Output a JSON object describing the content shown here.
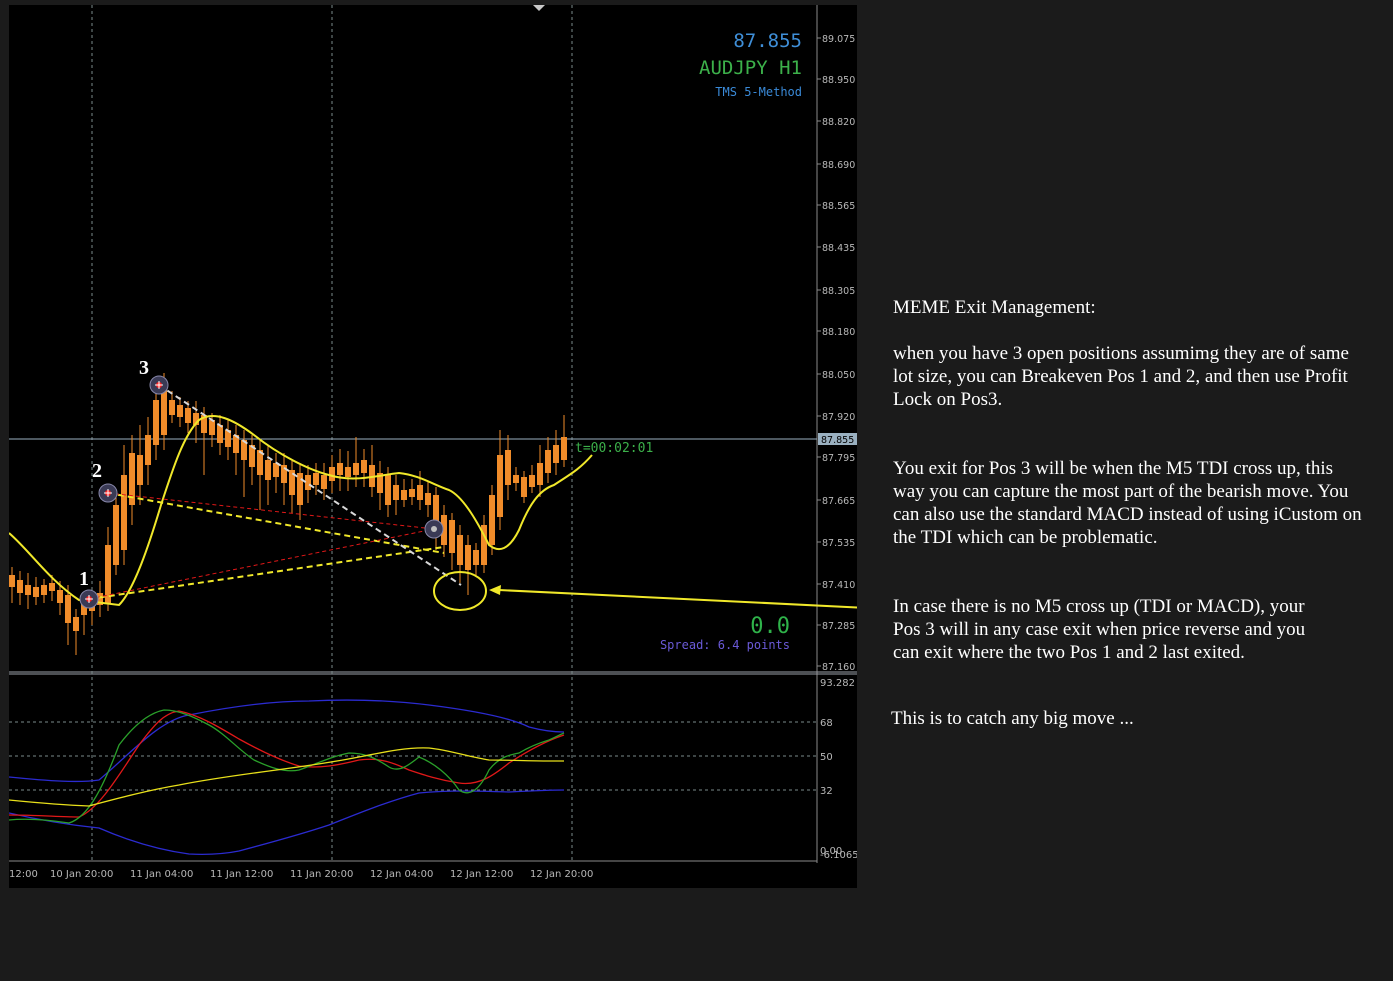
{
  "chart": {
    "price_readout": "87.855",
    "symbol": "AUDJPY H1",
    "indicator_name": "TMS 5-Method",
    "timer": "t=00:02:01",
    "profit": "0.0",
    "spread": "Spread: 6.4 points",
    "current_price_tag": "87.855",
    "colors": {
      "price_readout": "#3f8fd8",
      "symbol": "#3cb04a",
      "indicator_name": "#3a8ad8",
      "timer": "#3cb04a",
      "profit": "#2fb34a",
      "spread": "#6a5ad8",
      "bull_candle": "#4b5bdc",
      "bear_candle": "#f08c2a",
      "ma_line": "#f0e82a",
      "tdi_blue": "#2b2bd0",
      "tdi_red": "#e01818",
      "tdi_green": "#2aa02a",
      "tdi_yellow": "#e8e01a"
    },
    "price_axis": [
      "89.075",
      "88.950",
      "88.820",
      "88.690",
      "88.565",
      "88.435",
      "88.305",
      "88.180",
      "88.050",
      "87.920",
      "87.795",
      "87.665",
      "87.535",
      "87.410",
      "87.285",
      "87.160"
    ],
    "indicator_axis": [
      "93.282",
      "68",
      "50",
      "32",
      "0.00",
      "-6.1065"
    ],
    "time_axis": [
      "12:00",
      "10 Jan 20:00",
      "11 Jan 04:00",
      "11 Jan 12:00",
      "11 Jan 20:00",
      "12 Jan 04:00",
      "12 Jan 12:00",
      "12 Jan 20:00"
    ],
    "position_labels": [
      "1",
      "2",
      "3"
    ]
  },
  "notes": {
    "title": "MEME Exit Management:",
    "p1": "when you have 3 open positions assumimg they are of same lot size, you can Breakeven Pos 1 and 2, and then use Profit Lock on Pos3.",
    "p2": "You exit for Pos 3 will be when the M5 TDI cross up, this way you can capture the most part of the bearish move. You can also use the standard MACD instead of using iCustom on the TDI which can be problematic.",
    "p3": "In case there is no M5 cross up (TDI or MACD), your Pos 3 will in any case exit when price reverse and you can exit where the two Pos 1 and 2 last exited.",
    "p4": "This is to catch any big move ..."
  }
}
